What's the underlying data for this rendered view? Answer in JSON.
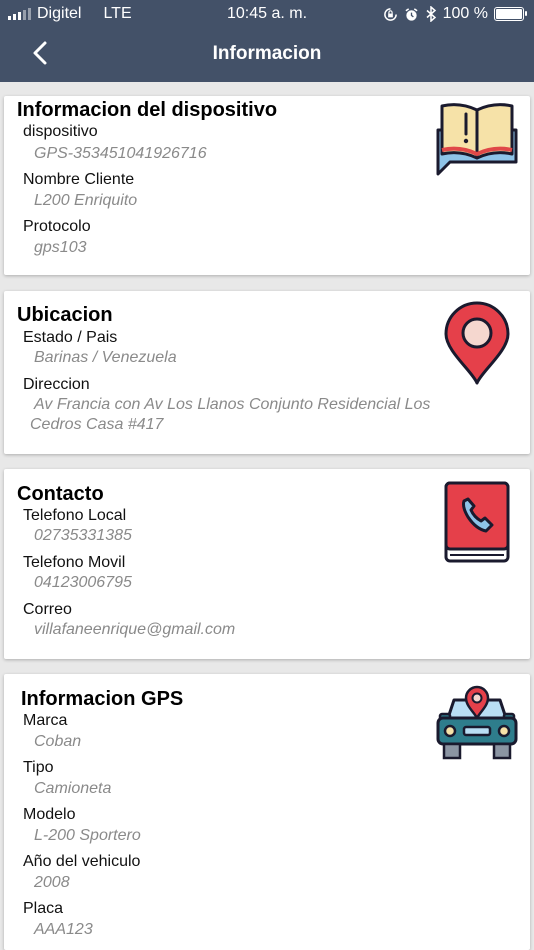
{
  "status_bar": {
    "carrier": "Digitel",
    "network": "LTE",
    "time": "10:45 a. m.",
    "battery": "100 %",
    "battery_level": 1.0
  },
  "nav": {
    "title": "Informacion",
    "back_icon": "chevron-left-icon"
  },
  "device": {
    "title": "Informacion del dispositivo",
    "icon": "open-book-icon",
    "fields": [
      {
        "label": "dispositivo",
        "value": "GPS-353451041926716"
      },
      {
        "label": "Nombre Cliente",
        "value": "L200 Enriquito"
      },
      {
        "label": "Protocolo",
        "value": "gps103"
      }
    ]
  },
  "location": {
    "title": "Ubicacion",
    "icon": "map-pin-icon",
    "fields": [
      {
        "label": "Estado / Pais",
        "value": "Barinas / Venezuela"
      },
      {
        "label": "Direccion",
        "value": "Av Francia con Av Los Llanos Conjunto Residencial Los Cedros Casa #417"
      }
    ]
  },
  "contact": {
    "title": "Contacto",
    "icon": "phone-book-icon",
    "fields": [
      {
        "label": "Telefono Local",
        "value": "02735331385"
      },
      {
        "label": "Telefono Movil",
        "value": "04123006795"
      },
      {
        "label": "Correo",
        "value": "villafaneenrique@gmail.com"
      }
    ]
  },
  "gps": {
    "title": "Informacion GPS",
    "icon": "car-location-icon",
    "fields": [
      {
        "label": "Marca",
        "value": "Coban"
      },
      {
        "label": "Tipo",
        "value": "Camioneta"
      },
      {
        "label": "Modelo",
        "value": "L-200 Sportero"
      },
      {
        "label": "Año del vehiculo",
        "value": "2008"
      },
      {
        "label": "Placa",
        "value": "AAA123"
      }
    ]
  }
}
